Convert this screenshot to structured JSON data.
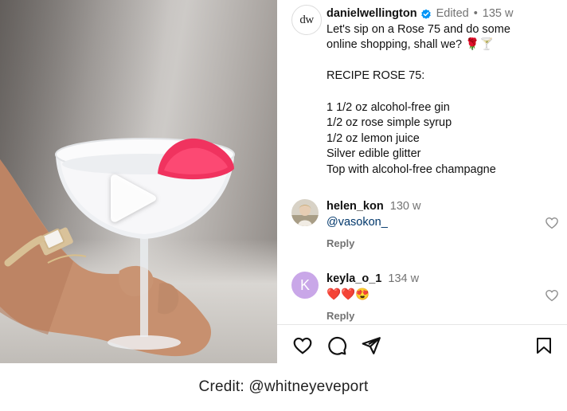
{
  "post": {
    "author_avatar_text": "dw",
    "author": "danielwellington",
    "edited_label": "Edited",
    "separator": "•",
    "age": "135 w",
    "caption_lines_top": [
      "Let's sip on a Rose 75 and do some",
      "online shopping, shall we? 🌹🍸"
    ],
    "recipe_title": "RECIPE ROSE 75:",
    "recipe_lines": [
      "1 1/2 oz alcohol-free gin",
      "1/2 oz rose simple syrup",
      "1/2 oz lemon juice",
      "Silver edible glitter",
      "Top with alcohol-free champagne"
    ]
  },
  "comments": [
    {
      "user": "helen_kon",
      "age": "130 w",
      "text": "@vasokon_",
      "reply_label": "Reply"
    },
    {
      "user": "keyla_o_1",
      "age": "134 w",
      "text": "❤️❤️😍",
      "reply_label": "Reply",
      "avatar_letter": "K"
    }
  ],
  "icons": {
    "play": "play-icon",
    "like": "heart-icon",
    "comment": "comment-icon",
    "share": "send-icon",
    "save": "bookmark-icon",
    "verified": "verified-badge-icon"
  },
  "colors": {
    "verified": "#0095f6",
    "mention": "#00376b",
    "muted": "#737373"
  },
  "footer": {
    "credit": "Credit: @whitneyeveport"
  }
}
